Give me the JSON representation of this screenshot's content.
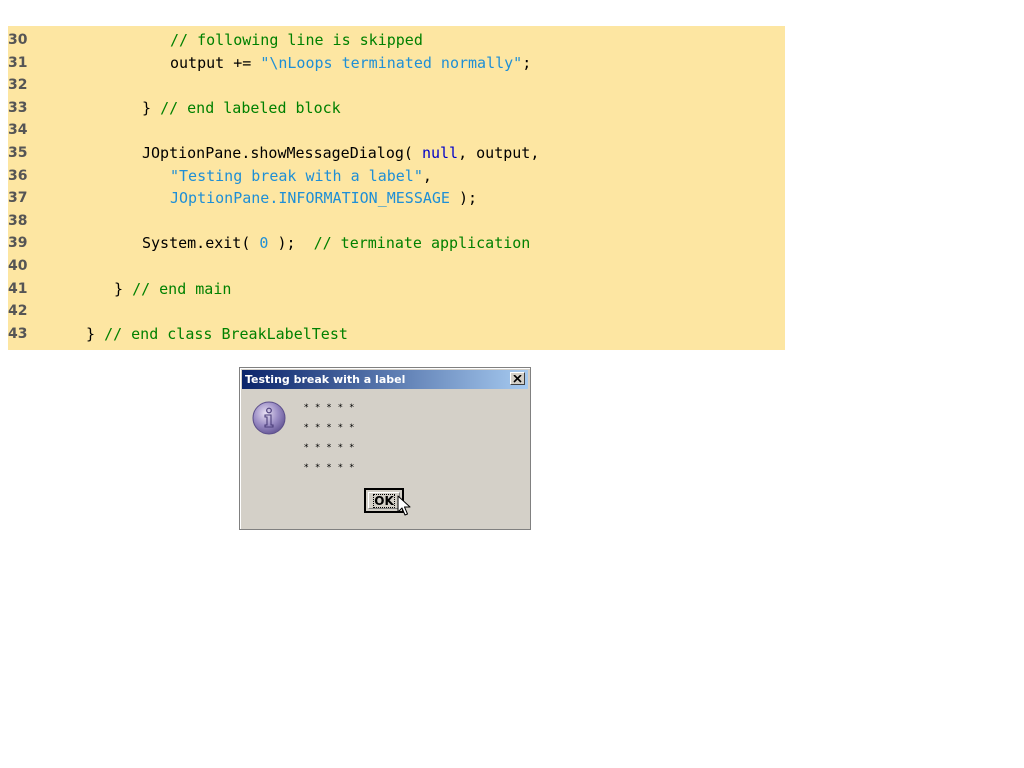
{
  "code": {
    "lines": [
      {
        "num": "30",
        "indent": 5,
        "parts": [
          {
            "t": "// following line is skipped",
            "c": "comment"
          }
        ]
      },
      {
        "num": "31",
        "indent": 5,
        "parts": [
          {
            "t": "output += ",
            "c": "plain"
          },
          {
            "t": "\"\\nLoops terminated normally\"",
            "c": "str"
          },
          {
            "t": ";",
            "c": "plain"
          }
        ]
      },
      {
        "num": "32",
        "indent": 0,
        "parts": []
      },
      {
        "num": "33",
        "indent": 4,
        "parts": [
          {
            "t": "} ",
            "c": "plain"
          },
          {
            "t": "// end labeled block",
            "c": "comment"
          }
        ]
      },
      {
        "num": "34",
        "indent": 0,
        "parts": []
      },
      {
        "num": "35",
        "indent": 4,
        "parts": [
          {
            "t": "JOptionPane.showMessageDialog( ",
            "c": "plain"
          },
          {
            "t": "null",
            "c": "kw"
          },
          {
            "t": ", output,",
            "c": "plain"
          }
        ]
      },
      {
        "num": "36",
        "indent": 5,
        "parts": [
          {
            "t": "\"Testing break with a label\"",
            "c": "str"
          },
          {
            "t": ",",
            "c": "plain"
          }
        ]
      },
      {
        "num": "37",
        "indent": 5,
        "parts": [
          {
            "t": "JOptionPane.INFORMATION_MESSAGE",
            "c": "const"
          },
          {
            "t": " );",
            "c": "plain"
          }
        ]
      },
      {
        "num": "38",
        "indent": 0,
        "parts": []
      },
      {
        "num": "39",
        "indent": 4,
        "parts": [
          {
            "t": "System.exit( ",
            "c": "plain"
          },
          {
            "t": "0",
            "c": "const"
          },
          {
            "t": " );  ",
            "c": "plain"
          },
          {
            "t": "// terminate application",
            "c": "comment"
          }
        ]
      },
      {
        "num": "40",
        "indent": 0,
        "parts": []
      },
      {
        "num": "41",
        "indent": 3,
        "parts": [
          {
            "t": "} ",
            "c": "plain"
          },
          {
            "t": "// end main",
            "c": "comment"
          }
        ]
      },
      {
        "num": "42",
        "indent": 0,
        "parts": []
      },
      {
        "num": "43",
        "indent": 2,
        "parts": [
          {
            "t": "} ",
            "c": "plain"
          },
          {
            "t": "// end class BreakLabelTest",
            "c": "comment"
          }
        ]
      }
    ]
  },
  "dialog": {
    "title": "Testing break with a label",
    "message_lines": [
      "* * * * *",
      "* * * * *",
      "* * * * *",
      "* * * * *"
    ],
    "ok_label": "OK",
    "icon": "information-icon",
    "close_icon": "close-icon",
    "cursor_icon": "mouse-pointer-icon"
  },
  "colors": {
    "code_background": "#fde6a2",
    "comment": "#008000",
    "string": "#1e8fd6",
    "keyword": "#0000c8",
    "titlebar_start": "#0a246a",
    "titlebar_end": "#a6caf0",
    "dialog_face": "#d4d0c8"
  }
}
